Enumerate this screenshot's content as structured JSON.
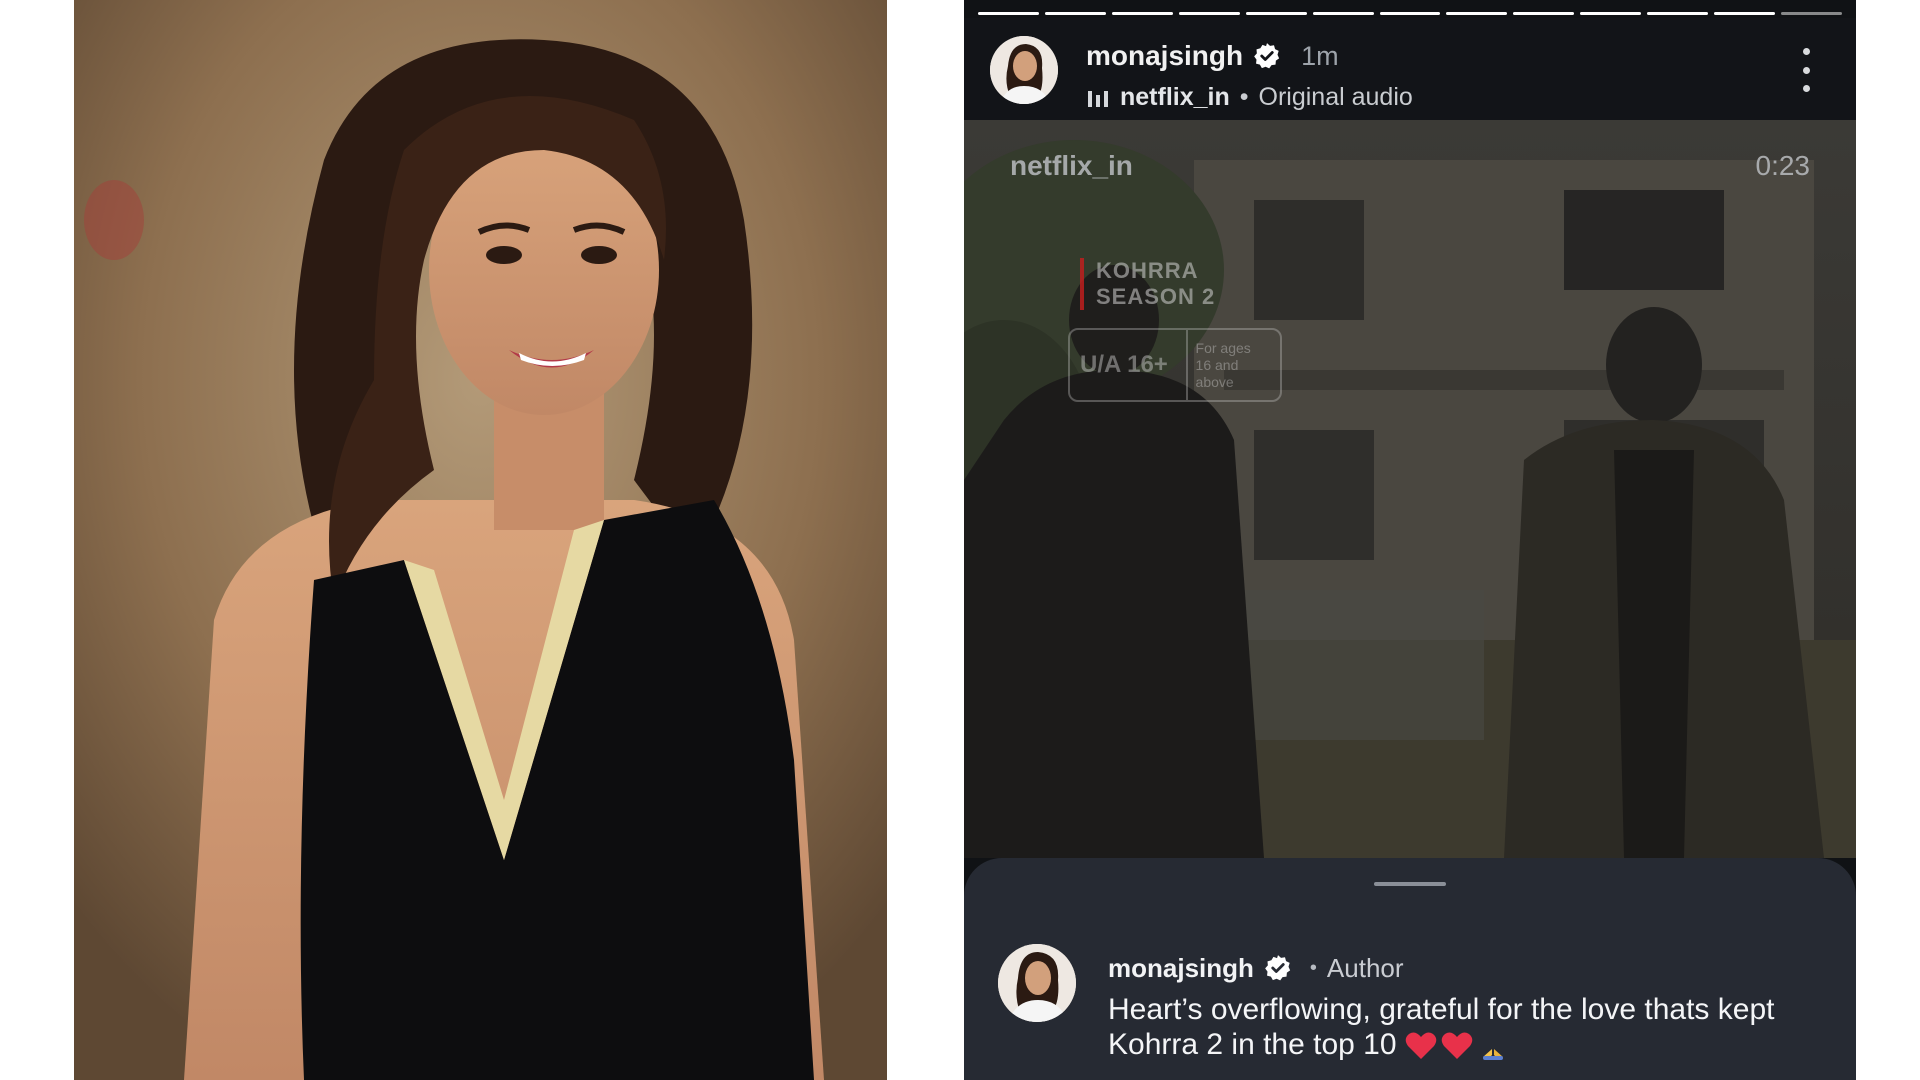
{
  "story": {
    "username": "monajsingh",
    "time": "1m",
    "audio_account": "netflix_in",
    "audio_separator": "•",
    "audio_label": "Original audio",
    "progress_segments": 13
  },
  "reel": {
    "account": "netflix_in",
    "timestamp": "0:23",
    "title_line1": "KOHRRA",
    "title_line2": "SEASON 2",
    "rating": "U/A 16+",
    "rating_note_line1": "For ages",
    "rating_note_line2": "16 and above"
  },
  "comment": {
    "username": "monajsingh",
    "separator": "•",
    "badge": "Author",
    "text": "Heart’s overflowing, grateful for the love thats kept Kohrra 2 in the top 10",
    "emojis": [
      "heart-emoji",
      "heart-emoji",
      "folded-hands-emoji"
    ]
  },
  "colors": {
    "story_bg": "#101215",
    "sheet_bg": "#262a33",
    "verified": "#ffffff",
    "heart": "#e8314a",
    "accent_red": "#c81e1e"
  }
}
